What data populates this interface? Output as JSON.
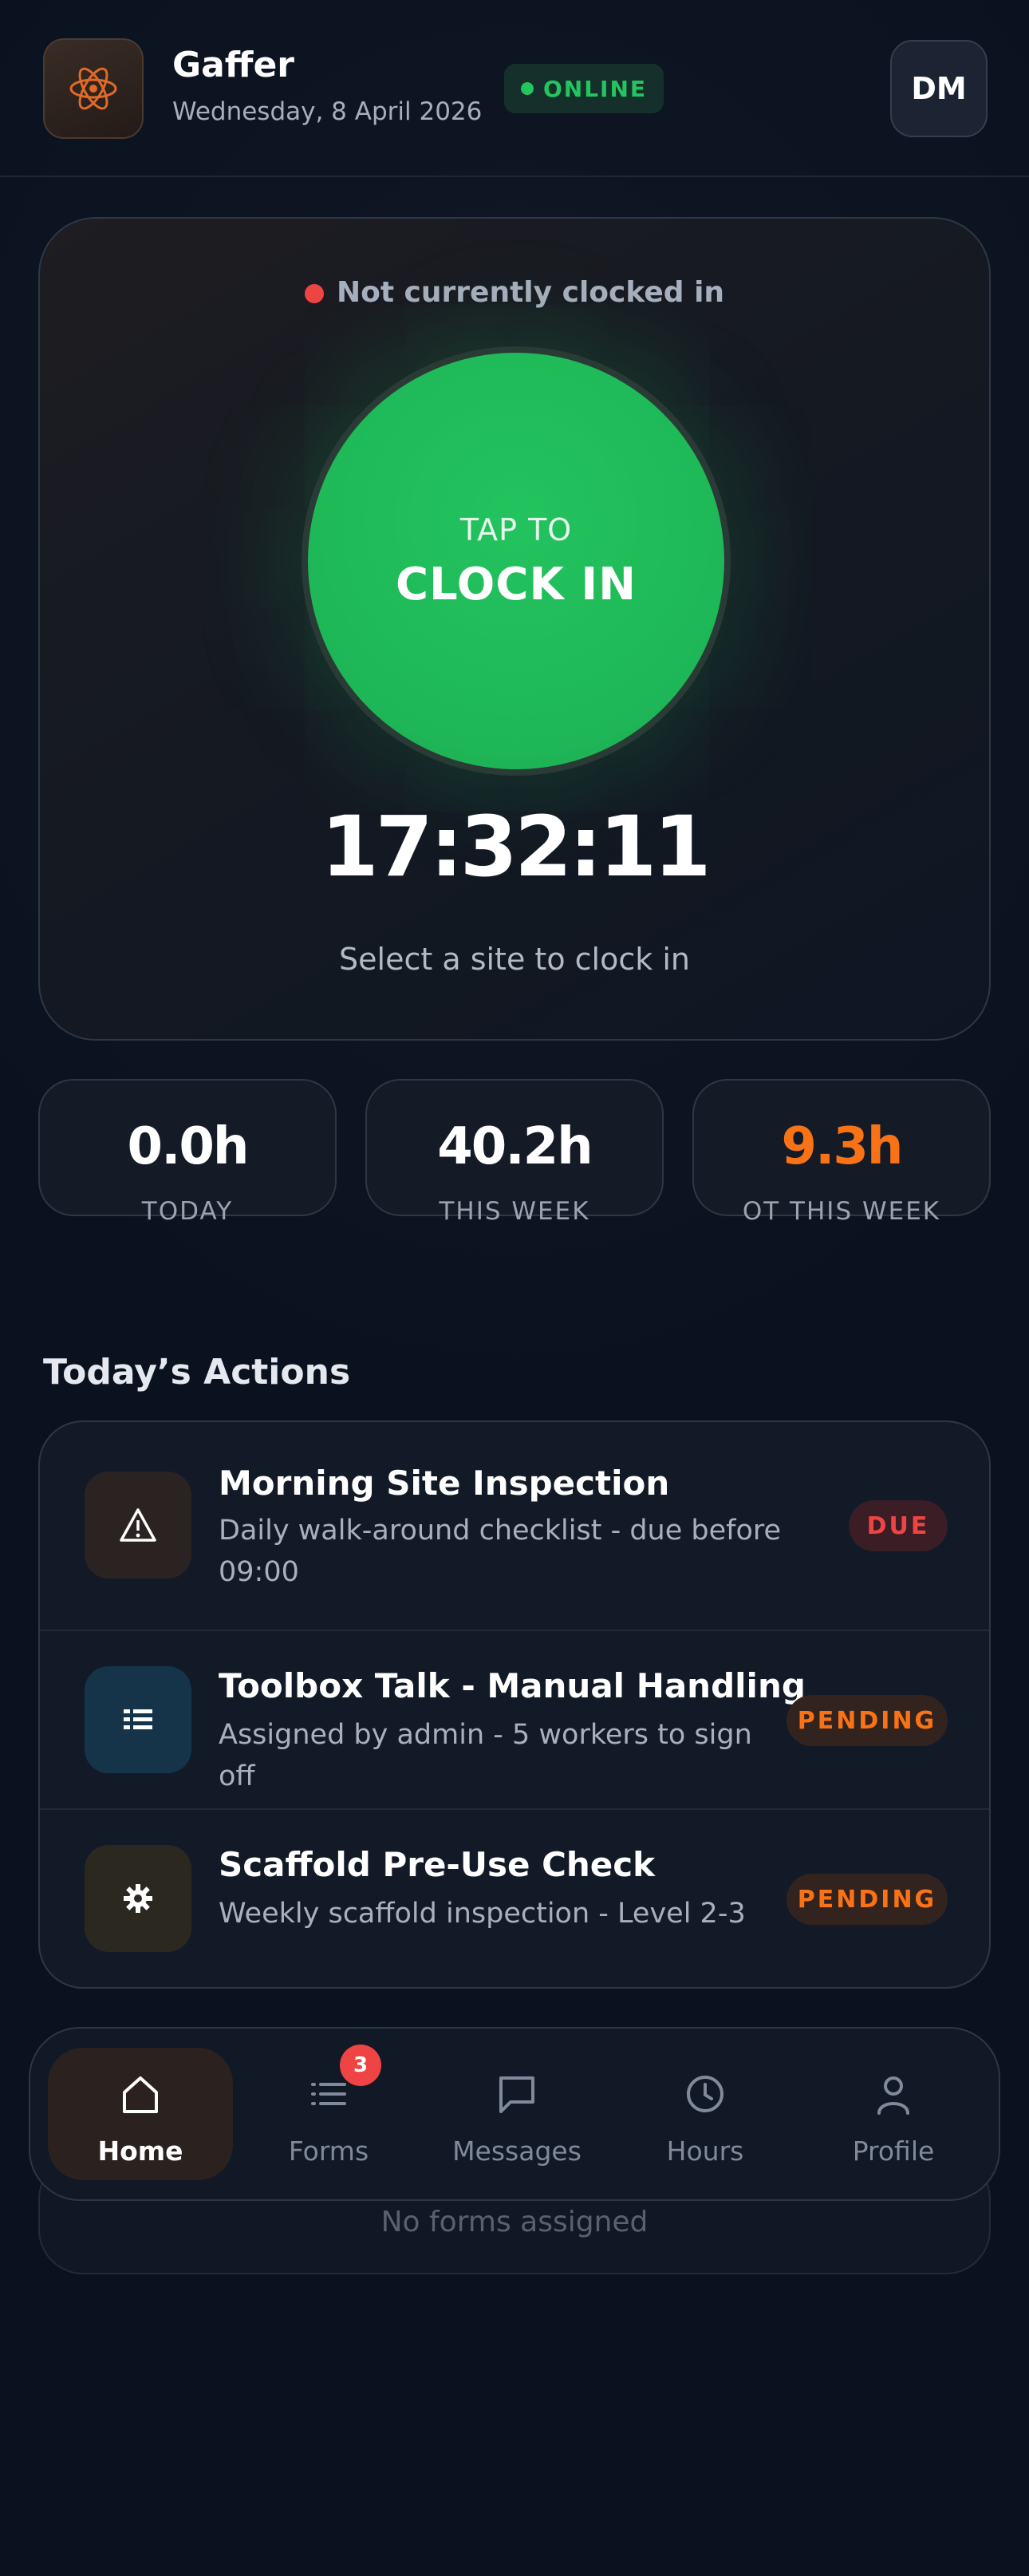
{
  "app": {
    "title": "Gaffer",
    "date": "Wednesday, 8 April 2026",
    "status": "ONLINE",
    "user_initials": "DM"
  },
  "clock": {
    "status_text": "Not currently clocked in",
    "tap_label": "TAP TO",
    "action_label": "CLOCK IN",
    "time": "17:32:11",
    "hint": "Select a site to clock in"
  },
  "stats": [
    {
      "value": "0.0h",
      "label": "TODAY",
      "color": "#ffffff"
    },
    {
      "value": "40.2h",
      "label": "THIS WEEK",
      "color": "#ffffff"
    },
    {
      "value": "9.3h",
      "label": "OT THIS WEEK",
      "color": "#f97316"
    }
  ],
  "actions": {
    "title": "Today’s Actions",
    "items": [
      {
        "icon": "warning-icon",
        "title": "Morning Site Inspection",
        "subtitle": "Daily walk-around checklist - due before 09:00",
        "status": "DUE"
      },
      {
        "icon": "checklist-icon",
        "title": "Toolbox Talk - Manual Handling",
        "subtitle": "Assigned by admin - 5 workers to sign off",
        "status": "PENDING"
      },
      {
        "icon": "gear-icon",
        "title": "Scaffold Pre-Use Check",
        "subtitle": "Weekly scaffold inspection - Level 2-3",
        "status": "PENDING"
      }
    ]
  },
  "forms_empty": "No forms assigned",
  "nav": {
    "items": [
      {
        "label": "Home",
        "icon": "home-icon",
        "active": true
      },
      {
        "label": "Forms",
        "icon": "list-icon",
        "badge": "3"
      },
      {
        "label": "Messages",
        "icon": "message-icon"
      },
      {
        "label": "Hours",
        "icon": "clock-icon"
      },
      {
        "label": "Profile",
        "icon": "user-icon"
      }
    ]
  },
  "colors": {
    "accent_green": "#22c55e",
    "accent_orange": "#f97316",
    "alert_red": "#ef4444",
    "background": "#0c1320"
  }
}
